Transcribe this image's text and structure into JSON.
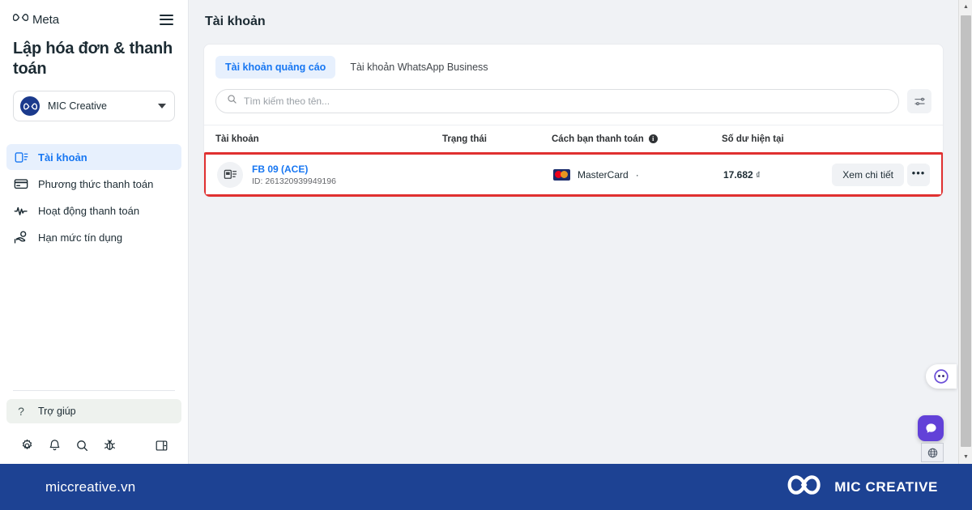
{
  "brand": {
    "meta_name": "Meta",
    "page_title": "Lập hóa đơn & thanh toán"
  },
  "business_selector": {
    "name": "MIC Creative",
    "avatar_text": "MIC CREATIVE"
  },
  "sidebar": {
    "items": [
      {
        "label": "Tài khoản",
        "icon": "accounts-icon",
        "active": true
      },
      {
        "label": "Phương thức thanh toán",
        "icon": "credit-card-icon",
        "active": false
      },
      {
        "label": "Hoạt động thanh toán",
        "icon": "activity-pulse-icon",
        "active": false
      },
      {
        "label": "Hạn mức tín dụng",
        "icon": "credit-limit-hand-icon",
        "active": false
      }
    ],
    "help_label": "Trợ giúp",
    "bottom_icons": [
      "gear-icon",
      "bell-icon",
      "search-icon",
      "bug-icon",
      "panel-toggle-icon"
    ]
  },
  "main": {
    "title": "Tài khoản",
    "tabs": [
      {
        "label": "Tài khoản quảng cáo",
        "active": true
      },
      {
        "label": "Tài khoản WhatsApp Business",
        "active": false
      }
    ],
    "search": {
      "placeholder": "Tìm kiếm theo tên...",
      "value": ""
    },
    "table": {
      "columns": {
        "account": "Tài khoản",
        "status": "Trạng thái",
        "payment": "Cách bạn thanh toán",
        "balance": "Số dư hiện tại"
      },
      "rows": [
        {
          "account_name": "FB 09 (ACE)",
          "account_id": "ID: 261320939949196",
          "status": "",
          "payment_brand": "MasterCard",
          "payment_suffix": "·",
          "balance_amount": "17.682",
          "balance_unit": "₫",
          "detail_button": "Xem chi tiết",
          "more_button": "•••",
          "highlighted": true
        }
      ]
    }
  },
  "widgets": {
    "chat_bubble": "messenger-face-icon",
    "message": "chat-icon",
    "globe": "globe-icon"
  },
  "footer": {
    "url": "miccreative.vn",
    "brand_name": "MIC CREATIVE"
  },
  "colors": {
    "accent_blue": "#1877f2",
    "highlight_red": "#e03030",
    "footer_blue": "#1d4293",
    "widget_purple": "#6241d8"
  }
}
